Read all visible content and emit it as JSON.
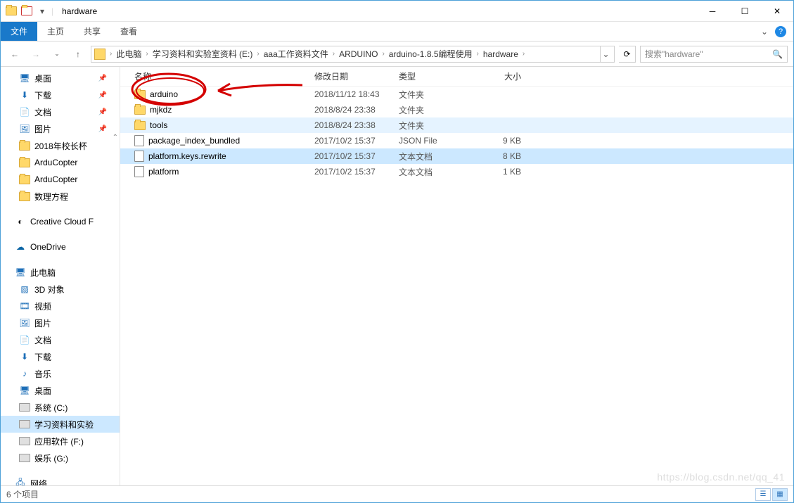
{
  "window": {
    "title": "hardware"
  },
  "ribbon": {
    "file": "文件",
    "home": "主页",
    "share": "共享",
    "view": "查看"
  },
  "breadcrumb": {
    "items": [
      "此电脑",
      "学习资料和实验室资料 (E:)",
      "aaa工作资料文件",
      "ARDUINO",
      "arduino-1.8.5编程使用",
      "hardware"
    ]
  },
  "search": {
    "placeholder": "搜索\"hardware\""
  },
  "columns": {
    "name": "名称",
    "date": "修改日期",
    "type": "类型",
    "size": "大小"
  },
  "rows": [
    {
      "name": "arduino",
      "date": "2018/11/12 18:43",
      "type": "文件夹",
      "size": "",
      "kind": "folder"
    },
    {
      "name": "mjkdz",
      "date": "2018/8/24 23:38",
      "type": "文件夹",
      "size": "",
      "kind": "folder"
    },
    {
      "name": "tools",
      "date": "2018/8/24 23:38",
      "type": "文件夹",
      "size": "",
      "kind": "folder",
      "alt": true
    },
    {
      "name": "package_index_bundled",
      "date": "2017/10/2 15:37",
      "type": "JSON File",
      "size": "9 KB",
      "kind": "file"
    },
    {
      "name": "platform.keys.rewrite",
      "date": "2017/10/2 15:37",
      "type": "文本文档",
      "size": "8 KB",
      "kind": "file",
      "selected": true
    },
    {
      "name": "platform",
      "date": "2017/10/2 15:37",
      "type": "文本文档",
      "size": "1 KB",
      "kind": "file"
    }
  ],
  "sidebar": {
    "quick": [
      {
        "label": "桌面",
        "icon": "desktop",
        "pinned": true
      },
      {
        "label": "下载",
        "icon": "download",
        "pinned": true
      },
      {
        "label": "文档",
        "icon": "doc",
        "pinned": true
      },
      {
        "label": "图片",
        "icon": "pic",
        "pinned": true
      },
      {
        "label": "2018年校长杯",
        "icon": "folder"
      },
      {
        "label": "ArduCopter",
        "icon": "folder"
      },
      {
        "label": "ArduCopter",
        "icon": "folder"
      },
      {
        "label": "数理方程",
        "icon": "folder"
      }
    ],
    "cloud1": "Creative Cloud F",
    "cloud2": "OneDrive",
    "thispc_label": "此电脑",
    "thispc": [
      {
        "label": "3D 对象",
        "icon": "3d"
      },
      {
        "label": "视频",
        "icon": "video"
      },
      {
        "label": "图片",
        "icon": "pic"
      },
      {
        "label": "文档",
        "icon": "doc"
      },
      {
        "label": "下载",
        "icon": "download"
      },
      {
        "label": "音乐",
        "icon": "music"
      },
      {
        "label": "桌面",
        "icon": "desktop"
      },
      {
        "label": "系统 (C:)",
        "icon": "drive"
      },
      {
        "label": "学习资料和实验",
        "icon": "drive",
        "selected": true
      },
      {
        "label": "应用软件 (F:)",
        "icon": "drive"
      },
      {
        "label": "娱乐 (G:)",
        "icon": "drive"
      }
    ],
    "network": "网络"
  },
  "status": {
    "count": "6 个项目"
  },
  "watermark": "https://blog.csdn.net/qq_41"
}
